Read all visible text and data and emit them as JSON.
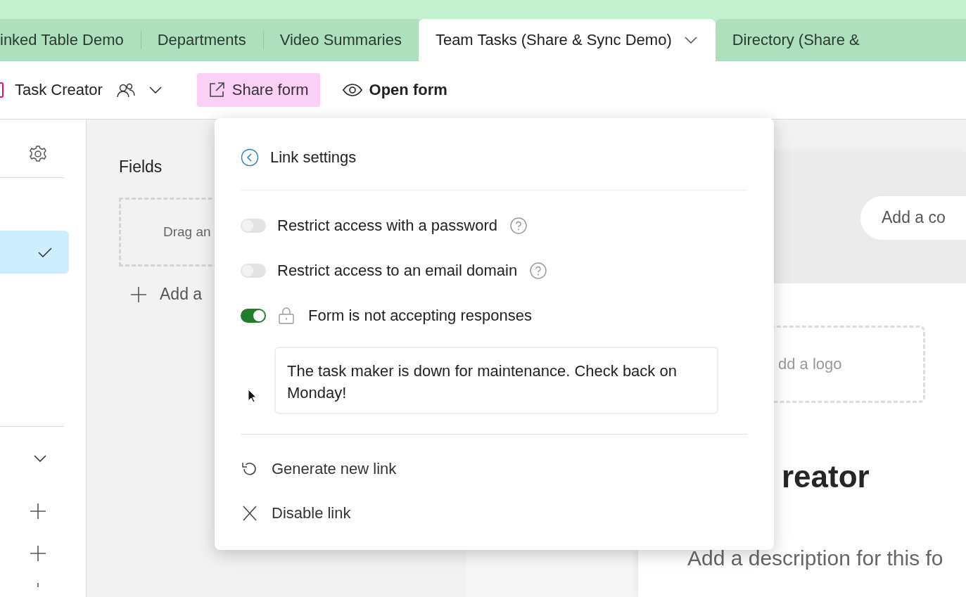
{
  "tabs": [
    {
      "label": "inked Table Demo",
      "selected": false
    },
    {
      "label": "Departments",
      "selected": false
    },
    {
      "label": "Video Summaries",
      "selected": false
    },
    {
      "label": "Team Tasks (Share & Sync Demo)",
      "selected": true
    },
    {
      "label": "Directory (Share &",
      "selected": false
    }
  ],
  "toolbar": {
    "form_name": "Task Creator",
    "share_button": {
      "label": "Share form",
      "active": true
    },
    "open_button": "Open form"
  },
  "sidebar": {
    "items": [
      {
        "selected": true
      }
    ]
  },
  "fields_panel": {
    "title": "Fields",
    "drop_hint": "Drag an",
    "add_button": "Add a"
  },
  "form_preview": {
    "cover_button": "Add a co",
    "logo_placeholder": "dd a logo",
    "title": "reator",
    "description_placeholder": "Add a description for this fo"
  },
  "popover": {
    "title": "Link settings",
    "options": [
      {
        "label": "Restrict access with a password",
        "on": false,
        "help": true,
        "locked": false
      },
      {
        "label": "Restrict access to an email domain",
        "on": false,
        "help": true,
        "locked": false
      },
      {
        "label": "Form is not accepting responses",
        "on": true,
        "help": false,
        "locked": true
      }
    ],
    "message": "The task maker is down for maintenance. Check back on Monday!",
    "actions": [
      {
        "label": "Generate new link",
        "kind": "regenerate"
      },
      {
        "label": "Disable link",
        "kind": "disable"
      }
    ]
  }
}
